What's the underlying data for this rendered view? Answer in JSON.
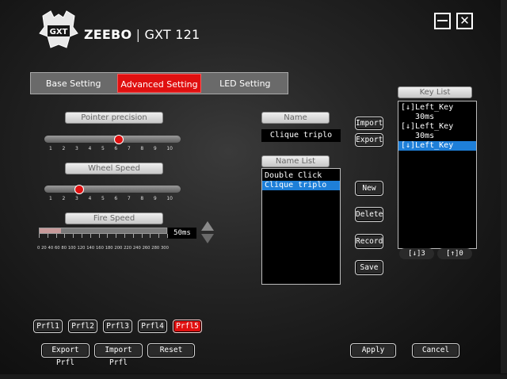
{
  "header": {
    "brand": "ZEEBO",
    "separator": "|",
    "model": "GXT 121",
    "logo_text": "GXT",
    "close_glyph": "✕"
  },
  "tabs": [
    {
      "label": "Base Setting",
      "active": false
    },
    {
      "label": "Advanced Setting",
      "active": true
    },
    {
      "label": "LED Setting",
      "active": false
    }
  ],
  "pointer_precision": {
    "label": "Pointer precision",
    "ticks": [
      "1",
      "2",
      "3",
      "4",
      "5",
      "6",
      "7",
      "8",
      "9",
      "10"
    ],
    "value": 6
  },
  "wheel_speed": {
    "label": "Wheel Speed",
    "ticks": [
      "1",
      "2",
      "3",
      "4",
      "5",
      "6",
      "7",
      "8",
      "9",
      "10"
    ],
    "value": 3
  },
  "fire_speed": {
    "label": "Fire Speed",
    "value_text": "50ms",
    "value_ms": 50,
    "ticks": [
      "0",
      "20",
      "40",
      "60",
      "80",
      "100",
      "120",
      "140",
      "160",
      "180",
      "200",
      "220",
      "240",
      "260",
      "280",
      "300"
    ]
  },
  "macro": {
    "name_label": "Name",
    "name_value": "Clique triplo",
    "name_list_label": "Name List",
    "name_list": [
      {
        "text": "Double Click",
        "selected": false
      },
      {
        "text": "Clique triplo",
        "selected": true
      }
    ],
    "buttons": {
      "import": "Import",
      "export": "Export",
      "new": "New",
      "delete": "Delete",
      "record": "Record",
      "save": "Save"
    }
  },
  "key_list": {
    "label": "Key List",
    "items": [
      {
        "text": "[↓]Left_Key",
        "selected": false
      },
      {
        "text": "   30ms",
        "selected": false
      },
      {
        "text": "[↓]Left_Key",
        "selected": false
      },
      {
        "text": "   30ms",
        "selected": false
      },
      {
        "text": "[↓]Left_Key",
        "selected": true
      }
    ],
    "down_count": "[↓]3",
    "up_count": "[↑]0"
  },
  "profiles": [
    {
      "label": "Prfl1",
      "active": false
    },
    {
      "label": "Prfl2",
      "active": false
    },
    {
      "label": "Prfl3",
      "active": false
    },
    {
      "label": "Prfl4",
      "active": false
    },
    {
      "label": "Prfl5",
      "active": true
    }
  ],
  "footer": {
    "export": "Export Prfl",
    "import": "Import Prfl",
    "reset": "Reset",
    "apply": "Apply",
    "cancel": "Cancel"
  },
  "colors": {
    "accent": "#e01010",
    "selection": "#1e7fd8"
  }
}
